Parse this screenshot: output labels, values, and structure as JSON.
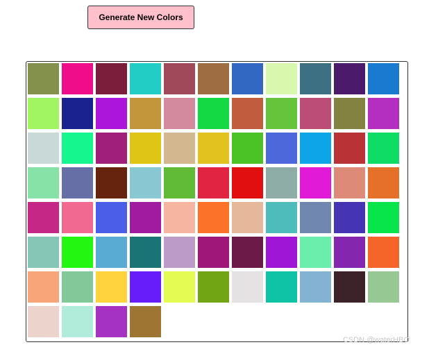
{
  "controls": {
    "generate_label": "Generate New Colors"
  },
  "watermark": "CSDN @waterHBO",
  "swatches": [
    "#84914c",
    "#f00d8a",
    "#7b1e3b",
    "#22cdc5",
    "#a0495b",
    "#9e6d42",
    "#3268c2",
    "#d9f7ad",
    "#3e7084",
    "#4c1a6a",
    "#1a7ad0",
    "#a1f562",
    "#1a228f",
    "#ac16da",
    "#c3963b",
    "#d48a9e",
    "#14d944",
    "#c15c3e",
    "#66c33c",
    "#bb4d76",
    "#848241",
    "#b42fc0",
    "#c8d9d7",
    "#15f78e",
    "#a01f7a",
    "#dec516",
    "#d3b78e",
    "#e2c21f",
    "#4bc226",
    "#4d68da",
    "#0ea4e8",
    "#b93235",
    "#0fdc65",
    "#87e2a7",
    "#6670a6",
    "#66230e",
    "#89c7d3",
    "#62bb37",
    "#e02441",
    "#e10f0f",
    "#8fada7",
    "#e01ad6",
    "#dd8a79",
    "#e57029",
    "#c42786",
    "#f16890",
    "#4b5ee8",
    "#a01ba0",
    "#f5b5a0",
    "#fd7229",
    "#e5b89c",
    "#4dbcba",
    "#7088af",
    "#4534b3",
    "#08e54b",
    "#85c6b7",
    "#22f611",
    "#5aabd4",
    "#1a7375",
    "#bd9bc8",
    "#a0177a",
    "#6c1a48",
    "#9f16d6",
    "#6bedac",
    "#8526af",
    "#f5652a",
    "#f8a57a",
    "#82c898",
    "#fed33d",
    "#671cfa",
    "#e3fb52",
    "#72a513",
    "#e4e2e2",
    "#0fc4a6",
    "#83b2d3",
    "#3c2229",
    "#95c893",
    "#ecd3cb",
    "#b1ebd9",
    "#a632c4",
    "#9e7532"
  ]
}
